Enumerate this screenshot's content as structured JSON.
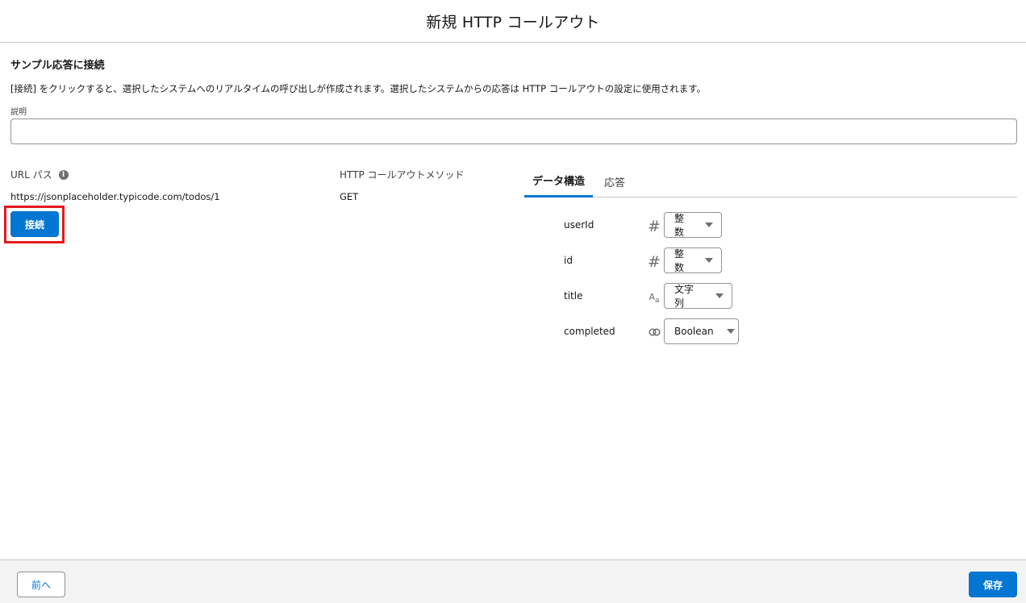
{
  "header": {
    "title": "新規 HTTP コールアウト"
  },
  "section": {
    "title": "サンプル応答に接続",
    "description": "[接続] をクリックすると、選択したシステムへのリアルタイムの呼び出しが作成されます。選択したシステムからの応答は HTTP コールアウトの設定に使用されます。",
    "field_label": "説明",
    "field_value": ""
  },
  "url": {
    "label": "URL パス",
    "info_icon": "info-icon",
    "value": "https://jsonplaceholder.typicode.com/todos/1",
    "connect_label": "接続"
  },
  "method": {
    "label": "HTTP コールアウトメソッド",
    "value": "GET"
  },
  "tabs": [
    {
      "label": "データ構造",
      "active": true
    },
    {
      "label": "応答",
      "active": false
    }
  ],
  "fields": [
    {
      "name": "userId",
      "icon": "number-icon",
      "glyph": "#",
      "type": "整数"
    },
    {
      "name": "id",
      "icon": "number-icon",
      "glyph": "#",
      "type": "整数"
    },
    {
      "name": "title",
      "icon": "text-icon",
      "glyph": "Aa",
      "type": "文字列"
    },
    {
      "name": "completed",
      "icon": "boolean-icon",
      "glyph": "",
      "type": "Boolean"
    }
  ],
  "footer": {
    "back_label": "前へ",
    "save_label": "保存"
  },
  "colors": {
    "brand": "#0176d3",
    "highlight": "#e4191c",
    "border": "#c9c9c9",
    "footer_bg": "#f3f3f3"
  }
}
